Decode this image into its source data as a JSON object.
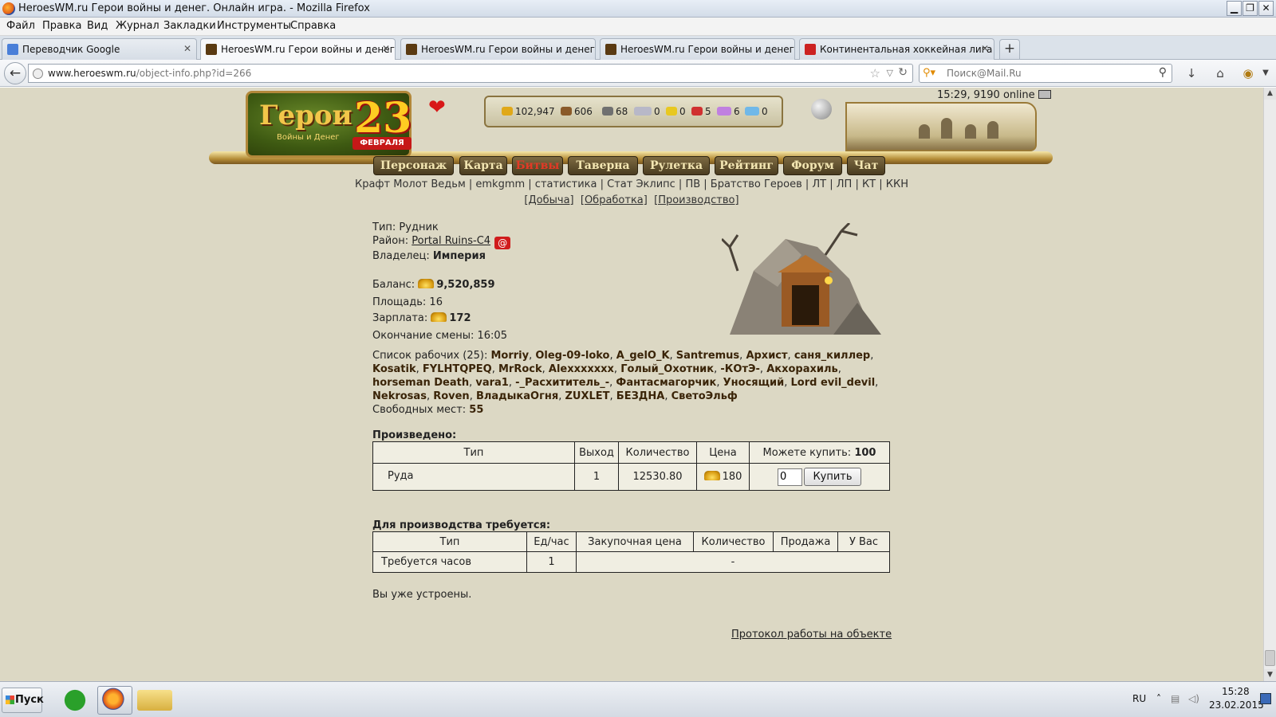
{
  "window": {
    "title": "HeroesWM.ru Герои войны и денег. Онлайн игра. - Mozilla Firefox",
    "min": "▁",
    "max": "❐",
    "close": "✕"
  },
  "menu": [
    "Файл",
    "Правка",
    "Вид",
    "Журнал",
    "Закладки",
    "Инструменты",
    "Справка"
  ],
  "tabs": [
    {
      "label": "Переводчик Google",
      "active": false
    },
    {
      "label": "HeroesWM.ru Герои войны и денег. ...",
      "active": true
    },
    {
      "label": "HeroesWM.ru Герои войны и денег. ...",
      "active": false
    },
    {
      "label": "HeroesWM.ru Герои войны и денег. ...",
      "active": false
    },
    {
      "label": "Континентальная хоккейная лига : ...",
      "active": false
    }
  ],
  "tab_close": "✕",
  "new_tab": "+",
  "nav": {
    "url_host": "www.heroeswm.ru",
    "url_path": "/object-info.php?id=266",
    "search_placeholder": "Поиск@Mail.Ru"
  },
  "header": {
    "logo_text": "Герои",
    "logo_sub": "Войны и Денег",
    "badge_num": "23",
    "badge_text": "ФЕВРАЛЯ",
    "online": "15:29, 9190 online",
    "resources": [
      {
        "name": "gold",
        "value": "102,947",
        "color": "#e0a818"
      },
      {
        "name": "wood",
        "value": "606",
        "color": "#8a5a2a"
      },
      {
        "name": "ore",
        "value": "68",
        "color": "#707070"
      },
      {
        "name": "mercury",
        "value": "0",
        "color": "#b8b8c8"
      },
      {
        "name": "sulfur",
        "value": "0",
        "color": "#e8c820"
      },
      {
        "name": "crystal",
        "value": "5",
        "color": "#d03030"
      },
      {
        "name": "gems",
        "value": "6",
        "color": "#c080e0"
      },
      {
        "name": "diamonds",
        "value": "0",
        "color": "#70b8e8"
      }
    ],
    "nav_items": [
      "Персонаж",
      "Карта",
      "Битвы",
      "Таверна",
      "Рулетка",
      "Рейтинг",
      "Форум",
      "Чат"
    ]
  },
  "sublinks": "Крафт Молот Ведьм | emkgmm | статистика | Стат Эклипс | ПВ | Братство Героев | ЛТ | ЛП | КТ | ККН",
  "sublinks2": [
    "[Добыча]",
    "[Обработка]",
    "[Производство]"
  ],
  "object": {
    "type_label": "Тип:",
    "type_value": "Рудник",
    "district_label": "Район:",
    "district_value": "Portal Ruins-C4",
    "owner_label": "Владелец:",
    "owner_value": "Империя",
    "balance_label": "Баланс:",
    "balance_value": "9,520,859",
    "area_label": "Площадь:",
    "area_value": "16",
    "salary_label": "Зарплата:",
    "salary_value": "172",
    "shift_label": "Окончание смены:",
    "shift_value": "16:05",
    "workers_label": "Список рабочих (25):",
    "workers": [
      "Morriy",
      "Oleg-09-loko",
      "A_gelO_K",
      "Santremus",
      "Архист",
      "саня_киллер",
      "Kosatik",
      "FYLHTQPEQ",
      "MrRock",
      "Alexxxxxxx",
      "Голый_Охотник",
      "-КОтЭ-",
      "Акхорахиль",
      "horseman Death",
      "vara1",
      "-_Расхититель_-",
      "Фантасмагорчик",
      "Уносящий",
      "Lord evil_devil",
      "Nekrosas",
      "Roven",
      "ВладыкаОгня",
      "ZUXLET",
      "БЕЗДНА",
      "СветоЭльф"
    ],
    "free_label": "Свободных мест:",
    "free_value": "55"
  },
  "produced": {
    "title": "Произведено:",
    "headers": [
      "Тип",
      "Выход",
      "Количество",
      "Цена"
    ],
    "can_buy_label": "Можете купить:",
    "can_buy_value": "100",
    "row": {
      "type": "Руда",
      "output": "1",
      "quantity": "12530.80",
      "price": "180"
    },
    "input_value": "0",
    "buy_label": "Купить"
  },
  "required": {
    "title": "Для производства требуется:",
    "headers": [
      "Тип",
      "Ед/час",
      "Закупочная цена",
      "Количество",
      "Продажа",
      "У Вас"
    ],
    "row": {
      "type": "Требуется часов",
      "per_hour": "1",
      "dash": "-"
    }
  },
  "already": "Вы уже устроены.",
  "protocol": "Протокол работы на объекте",
  "taskbar": {
    "start": "Пуск",
    "lang": "RU",
    "time": "15:28",
    "date": "23.02.2015"
  }
}
